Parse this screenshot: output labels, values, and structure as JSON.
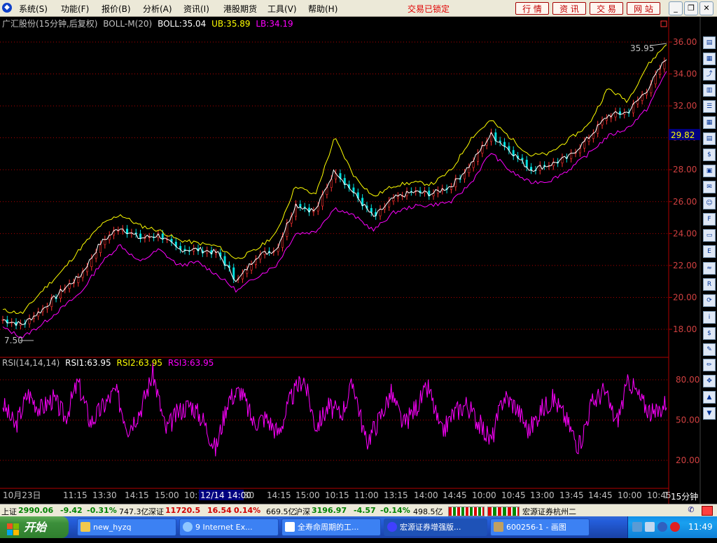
{
  "menubar": {
    "items": [
      "系统(S)",
      "功能(F)",
      "报价(B)",
      "分析(A)",
      "资讯(I)",
      "港股期货",
      "工具(V)",
      "帮助(H)"
    ],
    "lock_status": "交易已锁定",
    "tabs": [
      "行 情",
      "资 讯",
      "交 易",
      "网 站"
    ],
    "window_buttons": [
      "_",
      "❐",
      "✕"
    ]
  },
  "main_panel": {
    "header": {
      "name": "广汇股份(15分钟,后复权)",
      "indicator": "BOLL-M(20)",
      "boll": "BOLL:35.04",
      "ub": "UB:35.89",
      "lb": "LB:34.19"
    },
    "high_label": "35.95",
    "low_label": "7.50",
    "current_price": "29.82",
    "y_ticks": [
      "36.00",
      "34.00",
      "32.00",
      "30.00",
      "28.00",
      "26.00",
      "24.00",
      "22.00",
      "20.00",
      "18.00"
    ]
  },
  "rsi_panel": {
    "header": {
      "name": "RSI(14,14,14)",
      "rsi1": "RSI1:63.95",
      "rsi2": "RSI2:63.95",
      "rsi3": "RSI3:63.95"
    },
    "y_ticks": [
      "80.00",
      "50.00",
      "20.00"
    ]
  },
  "time_axis": {
    "labels": [
      "10月23日",
      "11:15",
      "13:30",
      "14:15",
      "15:00",
      "10:15",
      "12/14 14:00",
      "30",
      "14:15",
      "15:00",
      "10:15",
      "11:00",
      "13:15",
      "14:00",
      "14:45",
      "10:00",
      "10:45",
      "13:00",
      "13:45",
      "14:45",
      "10:00",
      "10:45",
      "1"
    ],
    "period": "15分钟"
  },
  "status_bar": {
    "sh_label": "上证",
    "sh_value": "2990.06",
    "sh_change": "-9.42",
    "sh_pct": "-0.31%",
    "sh_amount": "747.3亿",
    "sz_label": "深证",
    "sz_value": "11720.5",
    "sz_change": "16.54",
    "sz_pct": "0.14%",
    "sz_amount": "669.5亿",
    "hs_label": "沪深",
    "hs_value": "3196.97",
    "hs_change": "-4.57",
    "hs_pct": "-0.14%",
    "hs_amount": "498.5亿",
    "broker": "宏源证券杭州二"
  },
  "taskbar": {
    "start": "开始",
    "tasks": [
      "new_hyzq",
      "9 Internet Ex...",
      "全寿命周期的工...",
      "宏源证券增强版...",
      "600256-1 - 画图"
    ],
    "clock": "11:49"
  },
  "colors": {
    "price_up": "#ff3030",
    "price_down": "#00e0e0",
    "boll_mid": "#ffffff",
    "ub": "#ffff00",
    "lb": "#ff00ff",
    "rsi": "#ff00ff",
    "axis": "#b00000"
  },
  "chart_data": [
    {
      "type": "line",
      "title": "广汇股份(15分钟,后复权) BOLL-M(20)",
      "y_range": [
        16.5,
        37.0
      ],
      "series": [
        {
          "name": "BOLL",
          "values": [
            18.6,
            18.3,
            19.2,
            20.4,
            21.4,
            23.4,
            24.4,
            23.7,
            23.9,
            23.0,
            23.0,
            22.8,
            21.0,
            22.6,
            23.0,
            25.8,
            25.4,
            28.0,
            26.5,
            25.0,
            26.2,
            26.6,
            26.5,
            27.0,
            28.4,
            30.2,
            29.2,
            28.0,
            28.3,
            28.8,
            30.0,
            31.4,
            31.6,
            33.0,
            35.04
          ]
        },
        {
          "name": "UB",
          "values": [
            19.2,
            19.0,
            20.4,
            21.6,
            23.1,
            24.5,
            25.2,
            24.5,
            24.2,
            23.6,
            23.4,
            23.2,
            22.4,
            23.0,
            24.0,
            27.0,
            26.4,
            30.0,
            27.6,
            26.3,
            27.0,
            27.2,
            27.1,
            28.0,
            30.0,
            31.1,
            30.0,
            28.9,
            29.0,
            29.9,
            30.8,
            33.1,
            32.3,
            34.5,
            35.89
          ]
        },
        {
          "name": "LB",
          "values": [
            18.1,
            17.5,
            18.3,
            19.3,
            20.3,
            22.1,
            23.3,
            22.2,
            23.0,
            22.0,
            22.2,
            21.4,
            20.4,
            21.3,
            22.0,
            24.0,
            24.1,
            25.6,
            25.1,
            24.2,
            25.3,
            25.7,
            25.8,
            26.0,
            27.2,
            29.1,
            27.9,
            27.2,
            27.3,
            28.0,
            29.0,
            30.1,
            30.6,
            31.8,
            34.19
          ]
        }
      ],
      "high": 35.95,
      "low": 7.5
    },
    {
      "type": "line",
      "title": "RSI(14,14,14)",
      "y_range": [
        12,
        95
      ],
      "series": [
        {
          "name": "RSI1",
          "values": [
            62,
            45,
            70,
            58,
            66,
            52,
            78,
            48,
            60,
            72,
            44,
            58,
            85,
            42,
            56,
            62,
            50,
            28,
            66,
            72,
            48,
            52,
            40,
            66,
            82,
            45,
            60,
            54,
            78,
            33,
            50,
            70,
            46,
            60,
            74,
            40,
            55,
            62,
            48,
            34,
            68,
            60,
            42,
            58,
            66,
            50,
            30,
            62,
            72,
            48,
            80,
            64,
            53,
            63.95
          ]
        }
      ]
    }
  ]
}
